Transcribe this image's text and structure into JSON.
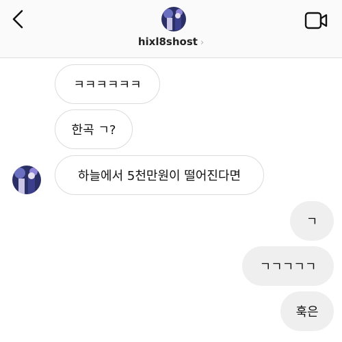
{
  "header": {
    "username": "hixl8shost",
    "username_chevron": "›"
  },
  "messages": {
    "incoming": [
      {
        "text": "ㅋㅋㅋㅋㅋㅋ"
      },
      {
        "text": "한곡 ㄱ?"
      },
      {
        "text": "하늘에서 5천만원이 떨어진다면"
      }
    ],
    "outgoing": [
      {
        "text": "ㄱ"
      },
      {
        "text": "ㄱㄱㄱㄱㄱ"
      },
      {
        "text": "훅은"
      }
    ]
  },
  "icons": {
    "back": "chevron-left-icon",
    "video": "video-camera-icon"
  },
  "colors": {
    "header_bg": "#fafafa",
    "incoming_border": "#dbdbdb",
    "outgoing_bg": "#efefef"
  }
}
